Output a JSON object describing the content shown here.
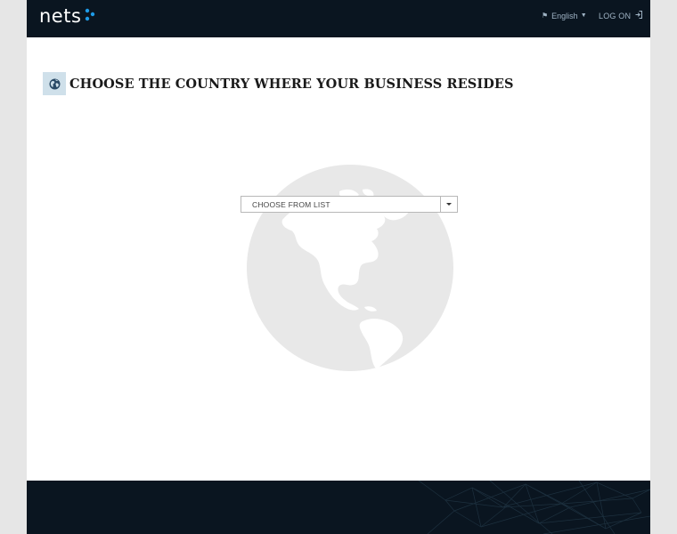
{
  "header": {
    "logo_text": "nets",
    "language_label": "English",
    "logon_label": "LOG ON"
  },
  "main": {
    "title": "CHOOSE THE COUNTRY WHERE YOUR BUSINESS RESIDES",
    "country_select": {
      "value": "CHOOSE FROM LIST"
    }
  },
  "colors": {
    "header_bg": "#0a1520",
    "badge_bg": "#cfe0ea",
    "globe_fill": "#e8e8e8",
    "logo_dot": "#1e9be8"
  },
  "icons": {
    "title_icon": "globe-icon",
    "language_icon": "flag-icon",
    "logon_icon": "sign-in-icon",
    "select_icon": "caret-down-icon"
  }
}
